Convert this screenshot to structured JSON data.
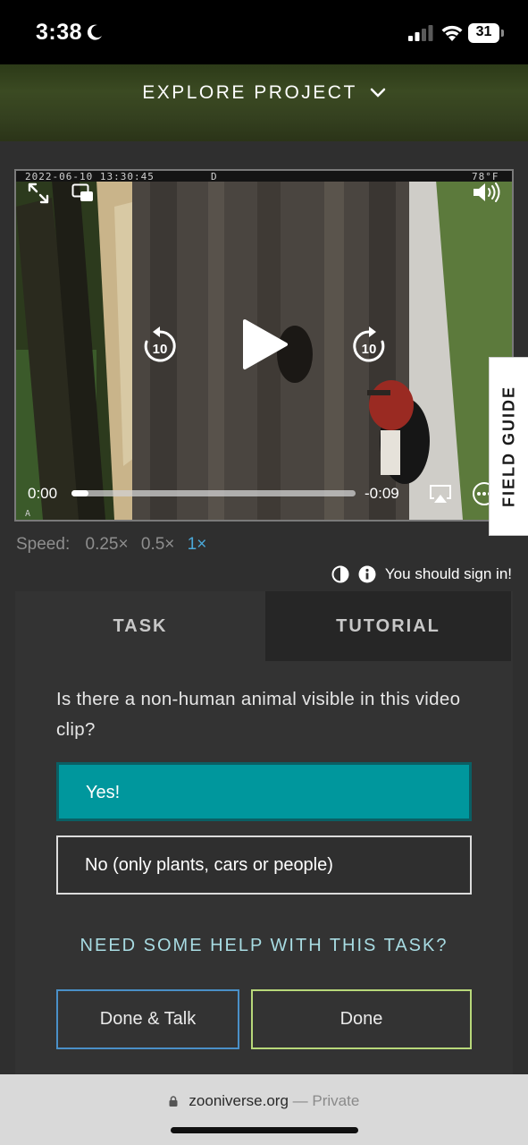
{
  "status_bar": {
    "time": "3:38",
    "battery": "31"
  },
  "header": {
    "explore_label": "EXPLORE PROJECT"
  },
  "video": {
    "osd_date": "2022-06-10 13:30:45",
    "osd_mode": "D",
    "osd_temp": "78°F",
    "osd_corner": "A",
    "time_current": "0:00",
    "time_remaining": "-0:09",
    "progress": 0.06,
    "skip_seconds": "10"
  },
  "field_guide": {
    "label": "FIELD GUIDE"
  },
  "speed": {
    "label": "Speed:",
    "options": [
      "0.25×",
      "0.5×",
      "1×"
    ],
    "selected": "1×"
  },
  "signin": {
    "message": "You should sign in!"
  },
  "task_panel": {
    "tabs": [
      {
        "label": "TASK",
        "active": true
      },
      {
        "label": "TUTORIAL",
        "active": false
      }
    ],
    "question": "Is there a non-human animal visible in this video clip?",
    "answers": [
      {
        "label": "Yes!",
        "selected": true
      },
      {
        "label": "No (only plants, cars or people)",
        "selected": false
      }
    ],
    "help_label": "NEED SOME HELP WITH THIS TASK?",
    "done_talk_label": "Done & Talk",
    "done_label": "Done"
  },
  "browser": {
    "domain": "zooniverse.org",
    "separator": "—",
    "privacy": "Private"
  },
  "colors": {
    "accent_teal": "#00979d",
    "help_text": "#a8dce3",
    "done_talk_border": "#4a90c8",
    "done_border": "#b8d87a",
    "speed_active": "#4aa8d8"
  }
}
